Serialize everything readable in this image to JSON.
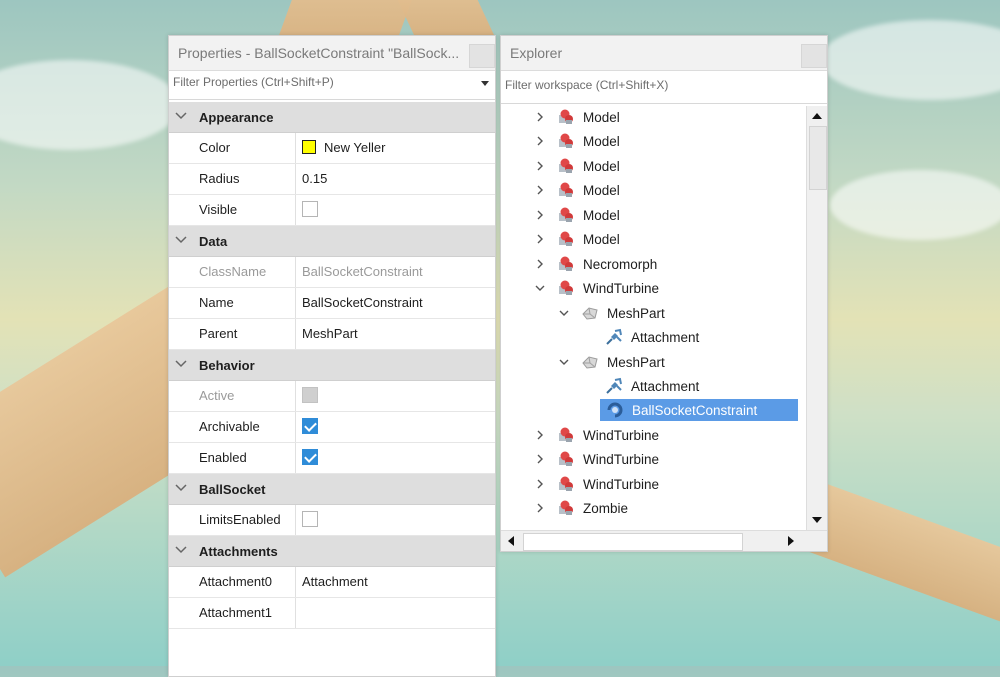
{
  "properties": {
    "title": "Properties - BallSocketConstraint \"BallSock...",
    "filter_placeholder": "Filter Properties (Ctrl+Shift+P)",
    "categories": {
      "appearance": "Appearance",
      "data": "Data",
      "behavior": "Behavior",
      "ballsocket": "BallSocket",
      "attachments": "Attachments"
    },
    "rows": {
      "color": {
        "name": "Color",
        "value": "New Yeller",
        "swatch": "#ffff00"
      },
      "radius": {
        "name": "Radius",
        "value": "0.15"
      },
      "visible": {
        "name": "Visible",
        "checked": false
      },
      "classname": {
        "name": "ClassName",
        "value": "BallSocketConstraint"
      },
      "name": {
        "name": "Name",
        "value": "BallSocketConstraint"
      },
      "parent": {
        "name": "Parent",
        "value": "MeshPart"
      },
      "active": {
        "name": "Active",
        "checked": false
      },
      "archivable": {
        "name": "Archivable",
        "checked": true
      },
      "enabled": {
        "name": "Enabled",
        "checked": true
      },
      "limitsenabled": {
        "name": "LimitsEnabled",
        "checked": false
      },
      "attachment0": {
        "name": "Attachment0",
        "value": "Attachment"
      },
      "attachment1": {
        "name": "Attachment1",
        "value": ""
      }
    }
  },
  "explorer": {
    "title": "Explorer",
    "filter_placeholder": "Filter workspace (Ctrl+Shift+X)",
    "nodes": [
      {
        "label": "Model"
      },
      {
        "label": "Model"
      },
      {
        "label": "Model"
      },
      {
        "label": "Model"
      },
      {
        "label": "Model"
      },
      {
        "label": "Model"
      },
      {
        "label": "Necromorph"
      },
      {
        "label": "WindTurbine"
      },
      {
        "label": "MeshPart"
      },
      {
        "label": "Attachment"
      },
      {
        "label": "MeshPart"
      },
      {
        "label": "Attachment"
      },
      {
        "label": "BallSocketConstraint"
      },
      {
        "label": "WindTurbine"
      },
      {
        "label": "WindTurbine"
      },
      {
        "label": "WindTurbine"
      },
      {
        "label": "Zombie"
      }
    ]
  },
  "colors": {
    "selection": "#5b9be6",
    "checkbox_checked": "#2f8cd8",
    "category_bg": "#dedede"
  }
}
